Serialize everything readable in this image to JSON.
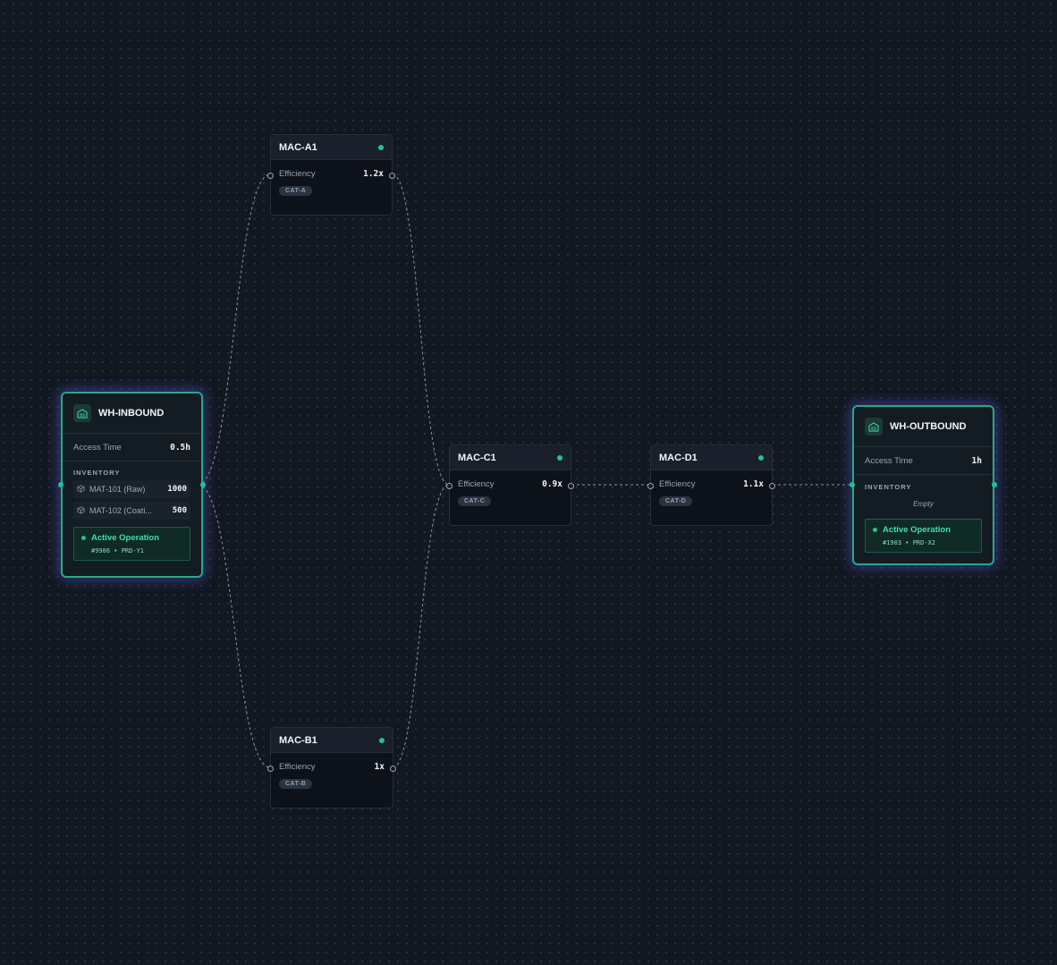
{
  "machines": [
    {
      "name": "MAC-A1",
      "metric_label": "Efficiency",
      "metric_value": "1.2x",
      "category": "CAT-A"
    },
    {
      "name": "MAC-B1",
      "metric_label": "Efficiency",
      "metric_value": "1x",
      "category": "CAT-B"
    },
    {
      "name": "MAC-C1",
      "metric_label": "Efficiency",
      "metric_value": "0.9x",
      "category": "CAT-C"
    },
    {
      "name": "MAC-D1",
      "metric_label": "Efficiency",
      "metric_value": "1.1x",
      "category": "CAT-D"
    }
  ],
  "warehouses": {
    "inbound": {
      "name": "WH-INBOUND",
      "access_label": "Access Time",
      "access_value": "0.5h",
      "inventory_label": "INVENTORY",
      "inventory": [
        {
          "name": "MAT-101 (Raw)",
          "qty": "1000"
        },
        {
          "name": "MAT-102 (Coati...",
          "qty": "500"
        }
      ],
      "operation": {
        "label": "Active Operation",
        "detail": "#9986 • PRD-Y1"
      }
    },
    "outbound": {
      "name": "WH-OUTBOUND",
      "access_label": "Access Time",
      "access_value": "1h",
      "inventory_label": "INVENTORY",
      "inventory_empty": "Empty",
      "operation": {
        "label": "Active Operation",
        "detail": "#1903 • PRD-X2"
      }
    }
  },
  "icons": {
    "warehouse": "warehouse-icon",
    "material": "cube-icon",
    "status": "status-dot-icon"
  },
  "colors": {
    "accent": "#22c38b",
    "node_border": "#2ba784",
    "glow": "#545ce6",
    "background": "#121820"
  }
}
